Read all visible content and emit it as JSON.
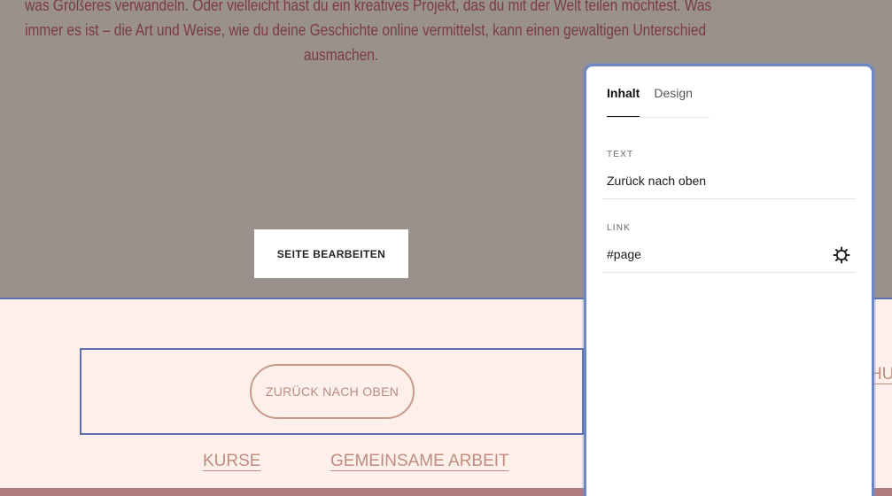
{
  "content": {
    "paragraph_lines": [
      "was Größeres verwandeln. Oder vielleicht hast du ein kreatives Projekt, das du mit der Welt teilen möchtest. Was",
      "immer es ist – die Art und Weise, wie du deine Geschichte online vermittelst, kann einen gewaltigen Unterschied",
      "ausmachen."
    ],
    "edit_button_label": "SEITE BEARBEITEN"
  },
  "footer": {
    "back_to_top_label": "ZURÜCK NACH OBEN",
    "nav": [
      {
        "label": "KURSE"
      },
      {
        "label": "GEMEINSAME ARBEIT"
      }
    ],
    "nav_cut_label": "HUT"
  },
  "panel": {
    "tabs": [
      {
        "label": "Inhalt",
        "active": true
      },
      {
        "label": "Design",
        "active": false
      }
    ],
    "text_label": "TEXT",
    "text_value": "Zurück nach oben",
    "link_label": "LINK",
    "link_value": "#page"
  },
  "colors": {
    "selection_outline": "#5b6fae",
    "footer_background": "#fdf0ea",
    "content_background": "#9a918d",
    "text_accent": "#7b3b3f"
  },
  "icons": {
    "link_settings": "gear-icon"
  }
}
